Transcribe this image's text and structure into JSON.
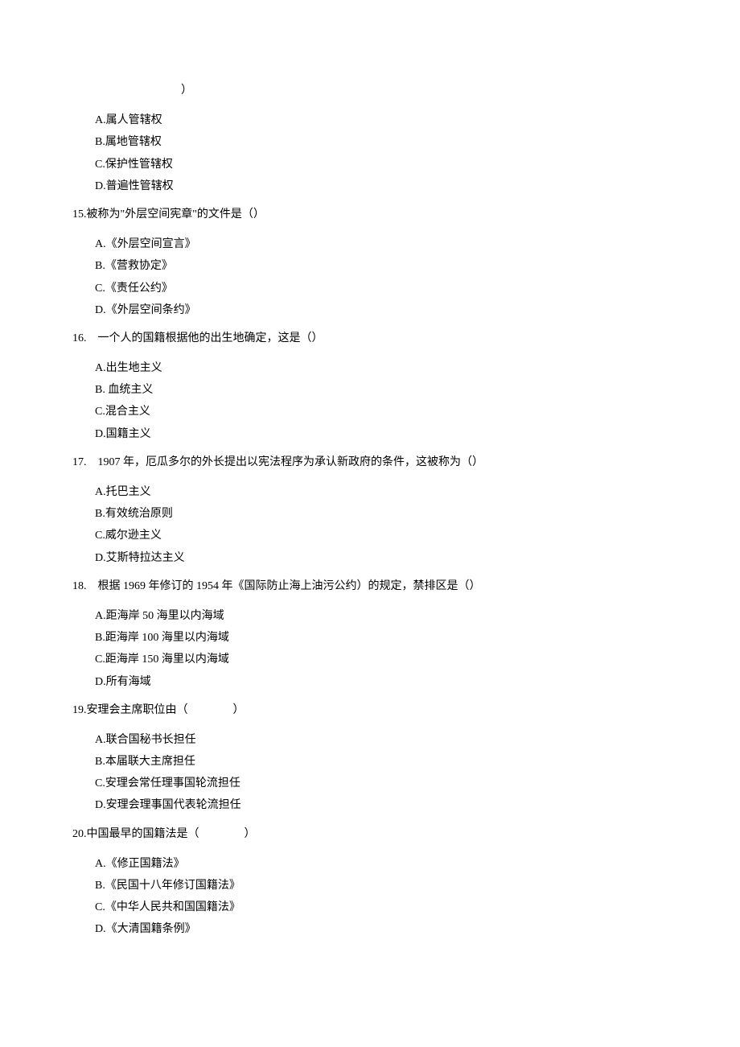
{
  "partial": "）",
  "q14_options": {
    "a": "A.属人管辖权",
    "b": "B.属地管辖权",
    "c": "C.保护性管辖权",
    "d": "D.普遍性管辖权"
  },
  "q15": {
    "stem": "15.被称为\"外层空间宪章\"的文件是（）",
    "a": "A.《外层空间宣言》",
    "b": "B.《营救协定》",
    "c": "C.《责任公约》",
    "d": "D.《外层空间条约》"
  },
  "q16": {
    "stem": "16.　一个人的国籍根据他的出生地确定，这是（）",
    "a": "A.出生地主义",
    "b": "B. 血统主义",
    "c": "C.混合主义",
    "d": "D.国籍主义"
  },
  "q17": {
    "stem": "17.　1907 年，厄瓜多尔的外长提出以宪法程序为承认新政府的条件，这被称为（）",
    "a": "A.托巴主义",
    "b": "B.有效统治原则",
    "c": "C.威尔逊主义",
    "d": "D.艾斯特拉达主义"
  },
  "q18": {
    "stem": "18.　根据 1969 年修订的 1954 年《国际防止海上油污公约）的规定，禁排区是（）",
    "a": "A.距海岸 50 海里以内海域",
    "b": "B.距海岸 100 海里以内海域",
    "c": "C.距海岸 150 海里以内海域",
    "d": "D.所有海域"
  },
  "q19": {
    "stem": "19.安理会主席职位由（　　　　）",
    "a": "A.联合国秘书长担任",
    "b": "B.本届联大主席担任",
    "c": "C.安理会常任理事国轮流担任",
    "d": "D.安理会理事国代表轮流担任"
  },
  "q20": {
    "stem": "20.中国最早的国籍法是（　　　　）",
    "a": "A.《修正国籍法》",
    "b": "B.《民国十八年修订国籍法》",
    "c": "C.《中华人民共和国国籍法》",
    "d": "D.《大清国籍条例》"
  }
}
